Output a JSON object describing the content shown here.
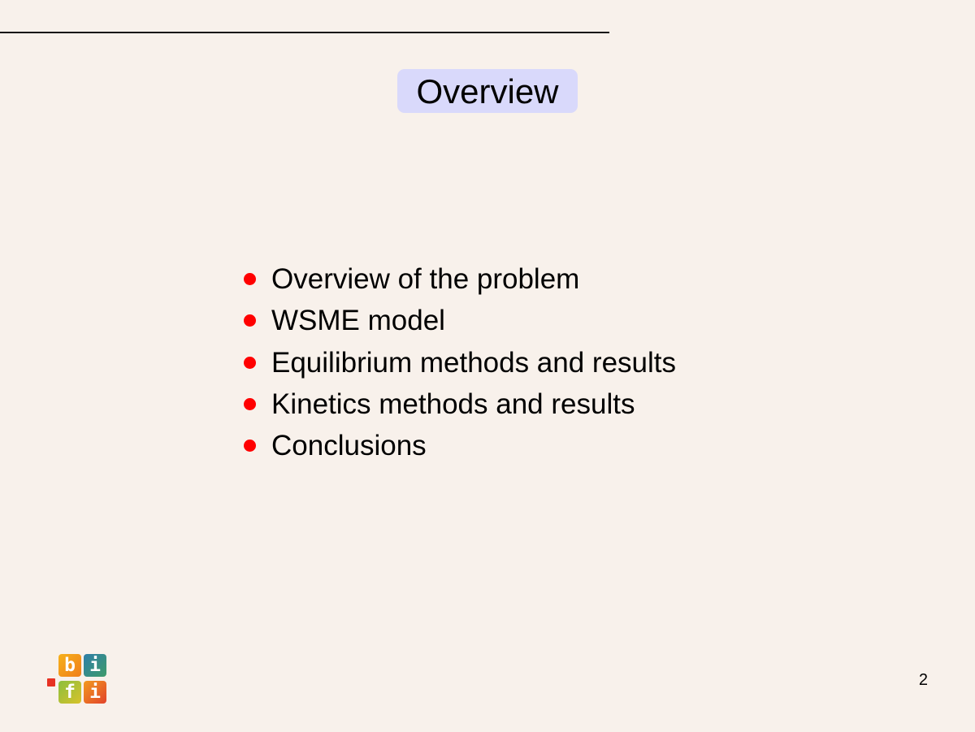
{
  "slide": {
    "title": "Overview",
    "bullets": [
      "Overview of the problem",
      "WSME model",
      "Equilibrium methods and results",
      "Kinetics methods and results",
      "Conclusions"
    ],
    "page_number": "2"
  },
  "logo": {
    "letters": [
      "b",
      "i",
      "f",
      "i"
    ]
  },
  "colors": {
    "background": "#f8f1eb",
    "title_box": "#d9d9fb",
    "bullet": "#ff0000",
    "logo_accent": "#e73223"
  }
}
